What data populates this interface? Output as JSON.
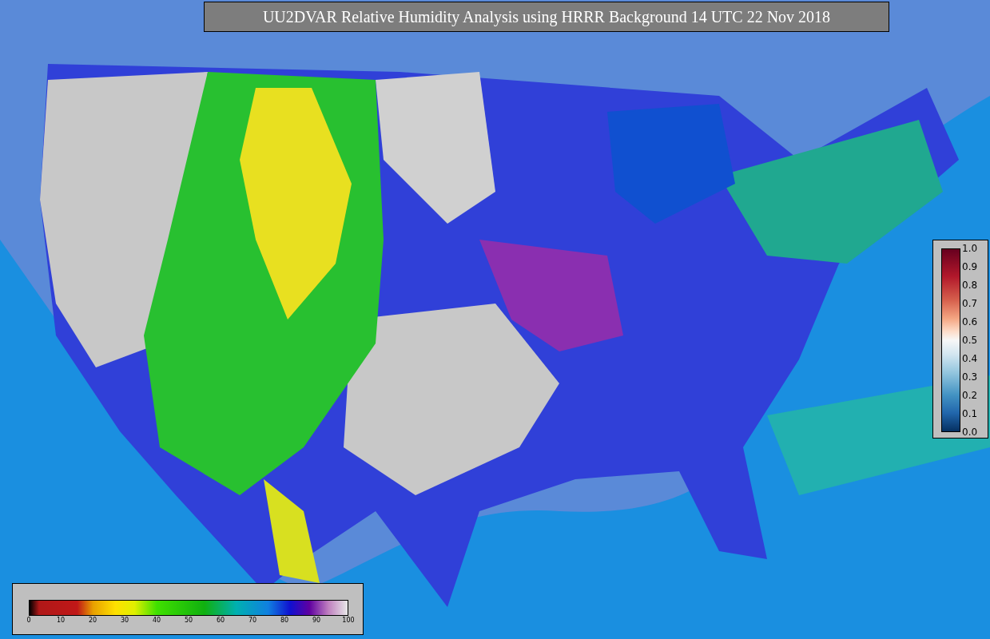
{
  "title": "UU2DVAR Relative Humidity Analysis using HRRR Background 14 UTC 22 Nov 2018",
  "ratio_scale": {
    "ticks": [
      "1.0",
      "0.9",
      "0.8",
      "0.7",
      "0.6",
      "0.5",
      "0.4",
      "0.3",
      "0.2",
      "0.1",
      "0.0"
    ]
  },
  "humidity_scale": {
    "ticks": [
      "0",
      "10",
      "20",
      "30",
      "40",
      "50",
      "60",
      "70",
      "80",
      "90",
      "100"
    ]
  }
}
